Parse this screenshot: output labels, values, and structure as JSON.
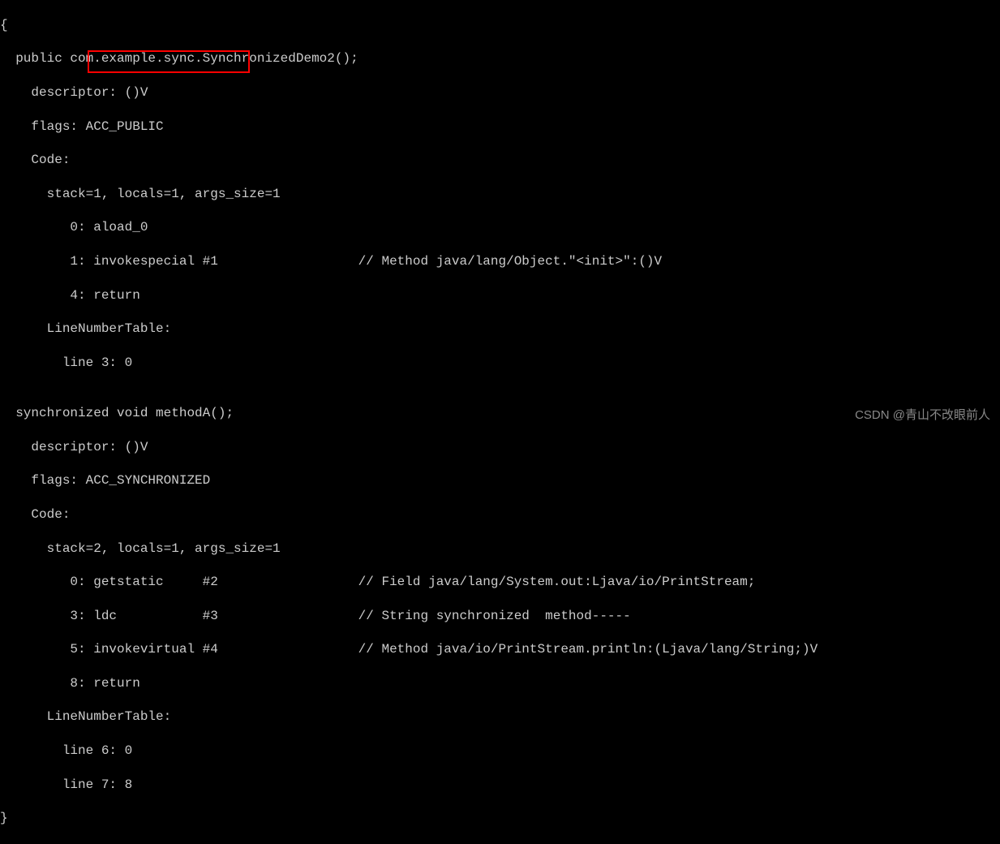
{
  "lines": {
    "l0": "{",
    "l1": "  public com.example.sync.SynchronizedDemo2();",
    "l2": "    descriptor: ()V",
    "l3": "    flags: ACC_PUBLIC",
    "l4": "    Code:",
    "l5": "      stack=1, locals=1, args_size=1",
    "l6": "         0: aload_0",
    "l7": "         1: invokespecial #1                  // Method java/lang/Object.\"<init>\":()V",
    "l8": "         4: return",
    "l9": "      LineNumberTable:",
    "l10": "        line 3: 0",
    "l11": "",
    "l12": "  synchronized void methodA();",
    "l13": "    descriptor: ()V",
    "l14": "    flags: ACC_SYNCHRONIZED",
    "l15": "    Code:",
    "l16": "      stack=2, locals=1, args_size=1",
    "l17": "         0: getstatic     #2                  // Field java/lang/System.out:Ljava/io/PrintStream;",
    "l18": "         3: ldc           #3                  // String synchronized  method-----",
    "l19": "         5: invokevirtual #4                  // Method java/io/PrintStream.println:(Ljava/lang/String;)V",
    "l20": "         8: return",
    "l21": "      LineNumberTable:",
    "l22": "        line 6: 0",
    "l23": "        line 7: 8",
    "l24": "}"
  },
  "highlight_target": "ACC_PUBLIC",
  "watermark": "CSDN @青山不改眼前人"
}
